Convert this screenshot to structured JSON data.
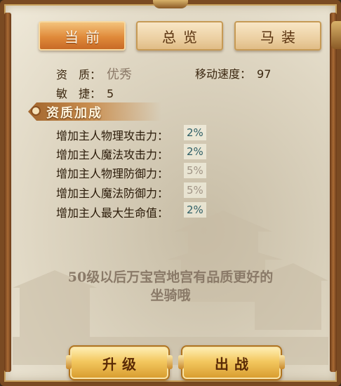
{
  "tabs": [
    {
      "label": "当前",
      "active": true
    },
    {
      "label": "总览",
      "active": false
    },
    {
      "label": "马装",
      "active": false
    }
  ],
  "stats": {
    "quality_label": "资　质：",
    "quality_value": "优秀",
    "speed_label": "移动速度：",
    "speed_value": "97",
    "agility_label": "敏　捷：",
    "agility_value": "5"
  },
  "section": {
    "title": "资质加成"
  },
  "bonuses": [
    {
      "label": "增加主人物理攻击力：",
      "value": "2%"
    },
    {
      "label": "增加主人魔法攻击力：",
      "value": "2%"
    },
    {
      "label": "增加主人物理防御力：",
      "value": "5%"
    },
    {
      "label": "增加主人魔法防御力：",
      "value": "5%"
    },
    {
      "label": "增加主人最大生命值：",
      "value": "2%"
    }
  ],
  "notice": {
    "line1": "50级以后万宝宫地宫有品质更好的",
    "line2": "坐骑哦"
  },
  "buttons": {
    "upgrade": "升级",
    "battle": "出战"
  },
  "colors": {
    "accent": "#e08a3a",
    "value_highlight": "#2f5f66",
    "value_dim": "#a09486",
    "text": "#3b2710"
  }
}
